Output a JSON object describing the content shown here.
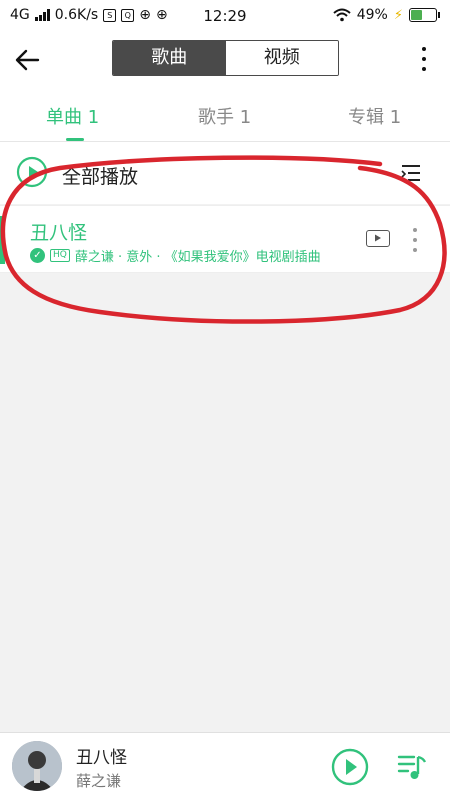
{
  "status_bar": {
    "network": "4G",
    "speed": "0.6K/s",
    "time": "12:29",
    "battery": "49%",
    "battery_level": 0.49,
    "mini_icons": [
      "S",
      "Q",
      "⊕",
      "⊕"
    ]
  },
  "header": {
    "segments": [
      "歌曲",
      "视频"
    ],
    "selected_segment": "歌曲"
  },
  "tabs": [
    {
      "label": "单曲 1",
      "active": true
    },
    {
      "label": "歌手 1",
      "active": false
    },
    {
      "label": "专辑 1",
      "active": false
    }
  ],
  "play_all": {
    "label": "全部播放"
  },
  "songs": [
    {
      "title": "丑八怪",
      "quality": "HQ",
      "meta": "薛之谦 · 意外 · 《如果我爱你》电视剧插曲"
    }
  ],
  "now_playing": {
    "title": "丑八怪",
    "artist": "薛之谦"
  },
  "colors": {
    "accent": "#31c27c",
    "annotation": "#d9262e",
    "segment_active": "#4a4a4a"
  }
}
